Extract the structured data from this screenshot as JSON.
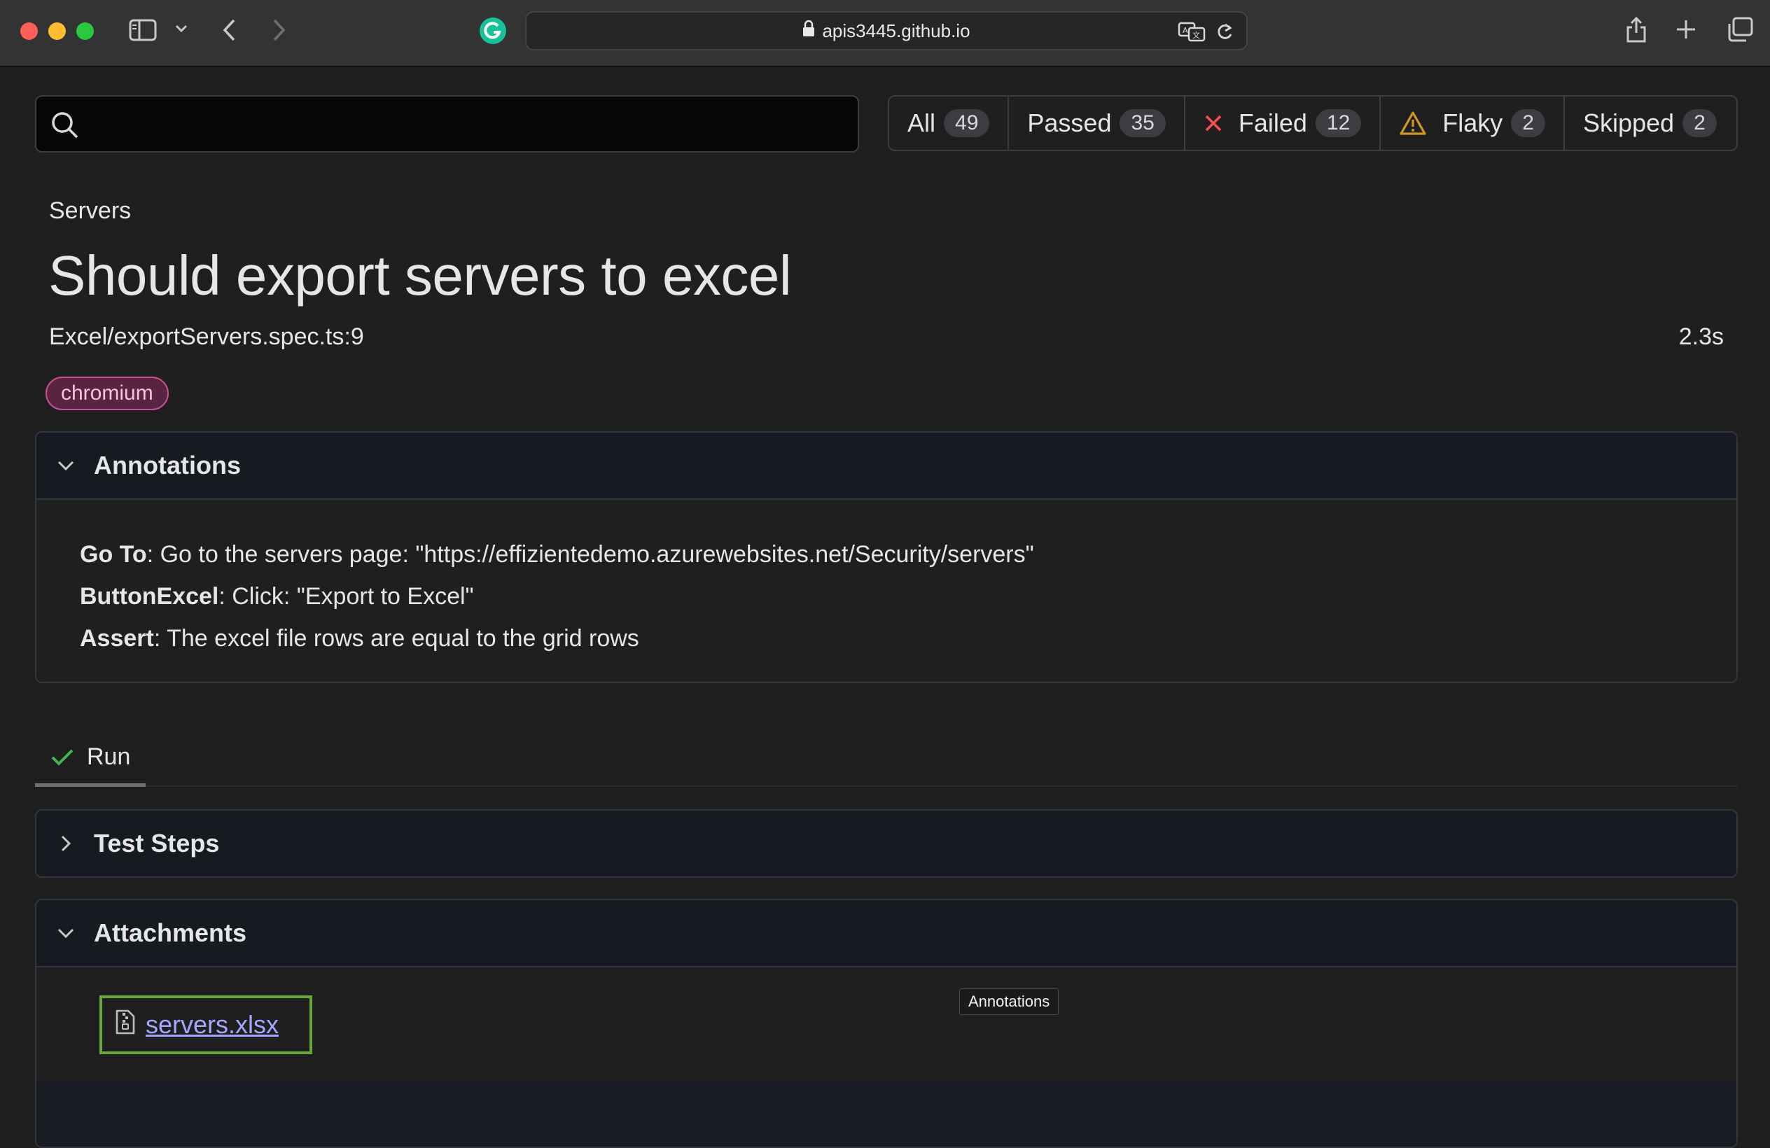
{
  "browser": {
    "url": "apis3445.github.io",
    "colors": {
      "close": "#fe5f57",
      "minimize": "#febc2e",
      "zoom": "#28c840"
    }
  },
  "search": {
    "value": "",
    "placeholder": ""
  },
  "filters": [
    {
      "label": "All",
      "count": "49"
    },
    {
      "label": "Passed",
      "count": "35"
    },
    {
      "label": "Failed",
      "count": "12",
      "icon": "x-icon",
      "color": "#f85149"
    },
    {
      "label": "Flaky",
      "count": "2",
      "icon": "warning-icon",
      "color": "#d29922"
    },
    {
      "label": "Skipped",
      "count": "2"
    }
  ],
  "test": {
    "breadcrumb": "Servers",
    "title": "Should export servers to excel",
    "location": "Excel/exportServers.spec.ts:9",
    "duration": "2.3s",
    "tag": "chromium"
  },
  "annotations": {
    "header": "Annotations",
    "items": [
      {
        "type": "Go To",
        "text": ": Go to the servers page: \"https://effizientedemo.azurewebsites.net/Security/servers\""
      },
      {
        "type": "ButtonExcel",
        "text": ": Click: \"Export to Excel\""
      },
      {
        "type": "Assert",
        "text": ": The excel file rows are equal to the grid rows"
      }
    ]
  },
  "tabs": {
    "run": "Run"
  },
  "test_steps": {
    "header": "Test Steps"
  },
  "attachments": {
    "header": "Attachments",
    "file": "servers.xlsx",
    "tooltip": "Annotations"
  }
}
